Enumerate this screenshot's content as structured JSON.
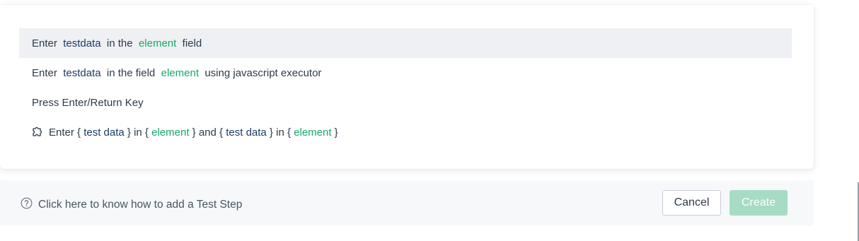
{
  "options": [
    {
      "parts": [
        "Enter  ",
        "testdata",
        "  in the  ",
        "element",
        "  field"
      ]
    },
    {
      "parts": [
        "Enter  ",
        "testdata",
        "  in the field  ",
        "element",
        "  using javascript executor"
      ]
    },
    {
      "text": "Press Enter/Return Key"
    },
    {
      "icon": "puzzle-piece-icon",
      "parts": [
        "Enter { ",
        "test data",
        " } in { ",
        "element",
        " } and { ",
        "test data",
        " } in { ",
        "element",
        " }"
      ]
    }
  ],
  "footer": {
    "help_icon": "question-circle-icon",
    "help_text": "Click here to know how to add a Test Step",
    "cancel_label": "Cancel",
    "create_label": "Create"
  },
  "colors": {
    "element": "#1aa86a",
    "param": "#1f3b63",
    "create_disabled": "#a5dcc3",
    "active_row": "#eef0f3",
    "footer_bg": "#f6f8fa"
  }
}
